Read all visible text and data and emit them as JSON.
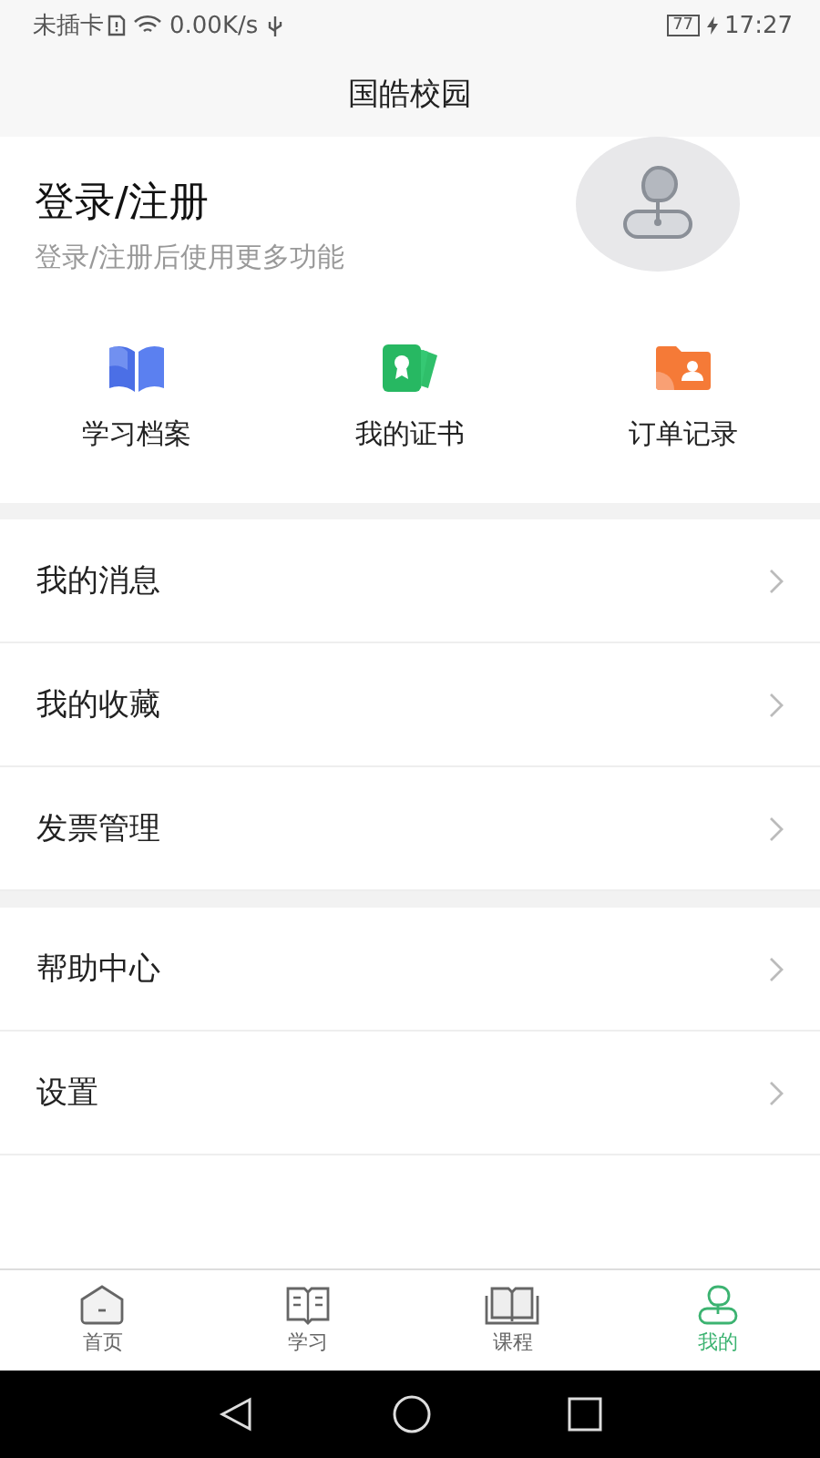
{
  "status_bar": {
    "carrier": "未插卡",
    "speed": "0.00K/s",
    "battery": "77",
    "time": "17:27"
  },
  "header": {
    "title": "国皓校园"
  },
  "profile": {
    "title": "登录/注册",
    "subtitle": "登录/注册后使用更多功能"
  },
  "shortcuts": [
    {
      "kind": "book",
      "label": "学习档案"
    },
    {
      "kind": "certificate",
      "label": "我的证书"
    },
    {
      "kind": "folder",
      "label": "订单记录"
    }
  ],
  "menu_groups": [
    {
      "items": [
        "我的消息",
        "我的收藏",
        "发票管理"
      ]
    },
    {
      "items": [
        "帮助中心",
        "设置"
      ]
    }
  ],
  "tabs": [
    {
      "kind": "home",
      "label": "首页",
      "selected": false
    },
    {
      "kind": "study",
      "label": "学习",
      "selected": false
    },
    {
      "kind": "course",
      "label": "课程",
      "selected": false
    },
    {
      "kind": "me",
      "label": "我的",
      "selected": true
    }
  ]
}
